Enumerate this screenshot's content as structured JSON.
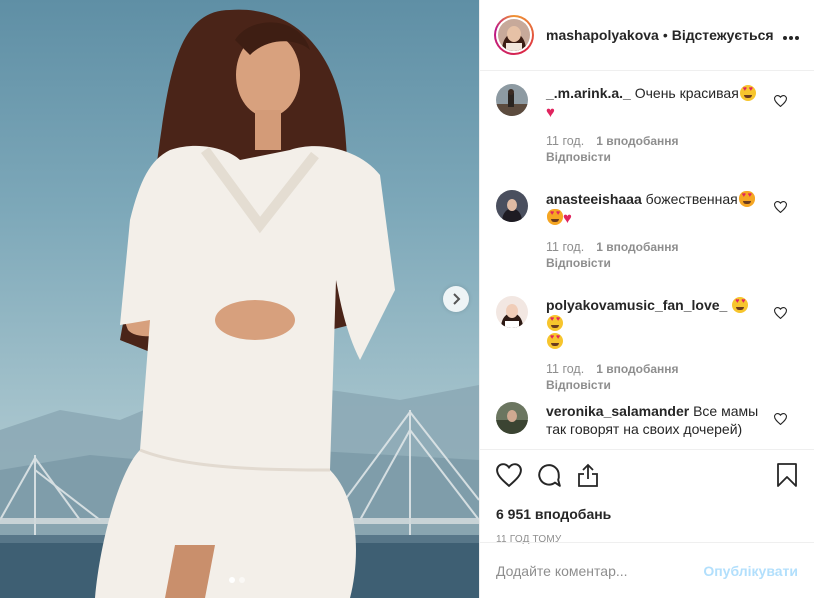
{
  "post": {
    "username": "mashapolyakova",
    "separator": "•",
    "follow_label": "Відстежується",
    "more_icon": "more-horizontal-icon"
  },
  "carousel": {
    "next_icon": "chevron-right-icon",
    "slide_count": 2,
    "active_slide": 1
  },
  "comments": [
    {
      "username": "_.m.arink.a._",
      "text": "Очень красивая",
      "emojis": [
        "heart-eyes",
        "red-heart"
      ],
      "time": "11 год.",
      "likes": "1 вподобання",
      "reply": "Відповісти"
    },
    {
      "username": "anasteeishaaa",
      "text": "божественная",
      "emojis": [
        "heart-eyes-cat",
        "heart-eyes-cat",
        "red-heart"
      ],
      "time": "11 год.",
      "likes": "1 вподобання",
      "reply": "Відповісти"
    },
    {
      "username": "polyakovamusic_fan_love_",
      "text": "",
      "emojis": [
        "heart-eyes",
        "heart-eyes",
        "heart-eyes"
      ],
      "time": "11 год.",
      "likes": "1 вподобання",
      "reply": "Відповісти"
    },
    {
      "username": "veronika_salamander",
      "text": "Все мамы так говорят на своих дочерей)",
      "emojis": [],
      "time": "",
      "likes": "",
      "reply": ""
    }
  ],
  "actions": {
    "like_icon": "heart-outline-icon",
    "comment_icon": "comment-icon",
    "share_icon": "share-icon",
    "save_icon": "bookmark-icon",
    "likes_total": "6 951 вподобань",
    "posted_ago": "11 ГОД ТОМУ"
  },
  "composer": {
    "placeholder": "Додайте коментар...",
    "publish_label": "Опублікувати"
  },
  "colors": {
    "link_disabled": "#b2dffc",
    "muted": "#8e8e8e",
    "text": "#262626",
    "like_red": "#e0245e"
  }
}
